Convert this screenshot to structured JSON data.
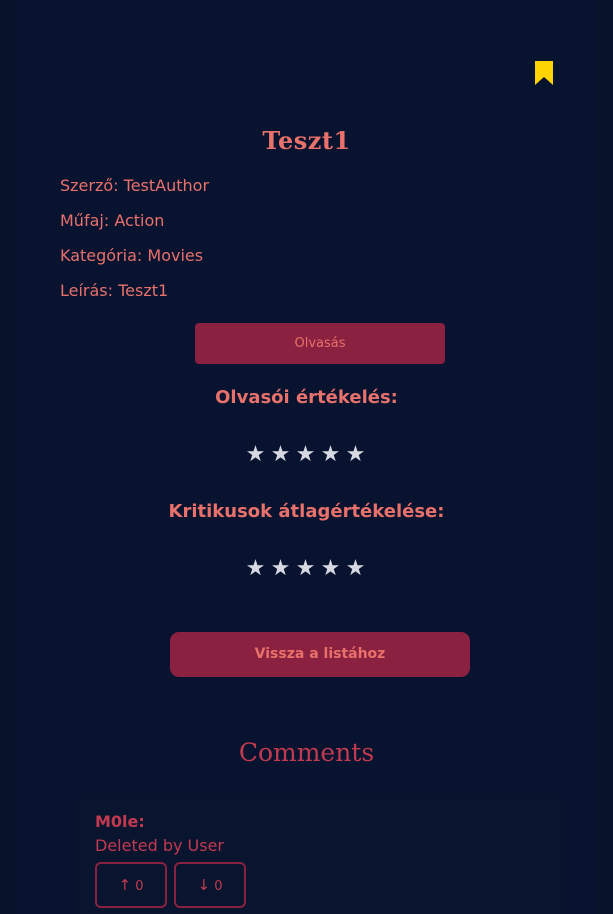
{
  "book": {
    "title": "Teszt1",
    "author_label": "Szerző:",
    "author": "TestAuthor",
    "genre_label": "Műfaj:",
    "genre": "Action",
    "category_label": "Kategória:",
    "category": "Movies",
    "description_label": "Leírás:",
    "description": "Teszt1"
  },
  "actions": {
    "read_label": "Olvasás",
    "back_label": "Vissza a listához"
  },
  "ratings": {
    "reader_label": "Olvasói értékelés:",
    "reader_stars": 0,
    "critic_label": "Kritikusok átlagértékelése:",
    "critic_stars": 0,
    "max_stars": 5
  },
  "comments": {
    "title": "Comments",
    "items": [
      {
        "user": "M0le",
        "text": "Deleted by User",
        "upvote_arrow": "↑",
        "upvotes": "0",
        "downvote_arrow": "↓",
        "downvotes": "0"
      }
    ]
  },
  "icons": {
    "bookmark": "bookmark-icon",
    "star": "star-icon"
  },
  "colors": {
    "background": "#08122b",
    "accent": "#e8716b",
    "button": "#8b2140",
    "comment_accent": "#c23a4f",
    "bookmark": "#ffd400",
    "star": "#d6d9e2"
  }
}
